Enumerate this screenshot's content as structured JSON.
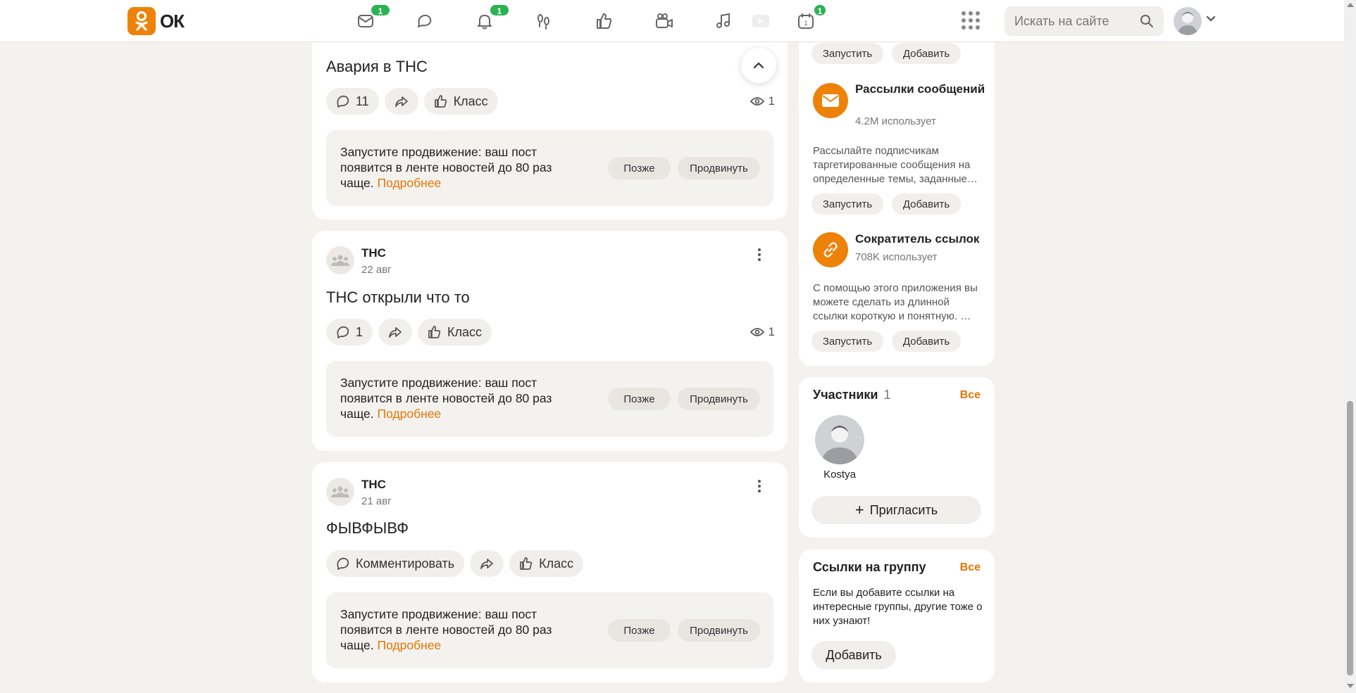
{
  "header": {
    "logo_text": "ОК",
    "badges": {
      "messages": "1",
      "notifications": "1",
      "events": "1"
    },
    "search_placeholder": "Искать на сайте",
    "accent": "#ee8208"
  },
  "posts": [
    {
      "title": "Авария в ТНС",
      "comments": "11",
      "class_label": "Класс",
      "views": "1",
      "promo": {
        "text": "Запустите продвижение: ваш пост появится в ленте новостей до 80 раз чаще.",
        "link": "Подробнее",
        "later": "Позже",
        "promote": "Продвинуть"
      }
    },
    {
      "author": "ТНС",
      "date": "22 авг",
      "title": "ТНС открыли что то",
      "comments": "1",
      "class_label": "Класс",
      "views": "1",
      "promo": {
        "text": "Запустите продвижение: ваш пост появится в ленте новостей до 80 раз чаще.",
        "link": "Подробнее",
        "later": "Позже",
        "promote": "Продвинуть"
      }
    },
    {
      "author": "ТНС",
      "date": "21 авг",
      "title": "ФЫВФЫВФ",
      "comment_label": "Комментировать",
      "class_label": "Класс",
      "promo": {
        "text": "Запустите продвижение: ваш пост появится в ленте новостей до 80 раз чаще.",
        "link": "Подробнее",
        "later": "Позже",
        "promote": "Продвинуть"
      }
    }
  ],
  "apps": {
    "top_buttons": {
      "launch": "Запустить",
      "add": "Добавить"
    },
    "items": [
      {
        "name": "Рассылки сообщений",
        "users": "4.2M использует",
        "desc": "Рассылайте подписчикам таргетированные сообщения на определенные темы, заданные…",
        "launch": "Запустить",
        "add": "Добавить"
      },
      {
        "name": "Сократитель ссылок",
        "users": "708K использует",
        "desc": "С помощью этого приложения вы можете сделать из длинной ссылки короткую и понятную. …",
        "launch": "Запустить",
        "add": "Добавить"
      }
    ]
  },
  "members": {
    "title": "Участники",
    "count": "1",
    "all": "Все",
    "people": [
      {
        "name": "Kostya"
      }
    ],
    "invite": "Пригласить"
  },
  "group_links": {
    "title": "Ссылки на группу",
    "all": "Все",
    "text": "Если вы добавите ссылки на интересные группы, другие тоже о них узнают!",
    "add": "Добавить"
  }
}
